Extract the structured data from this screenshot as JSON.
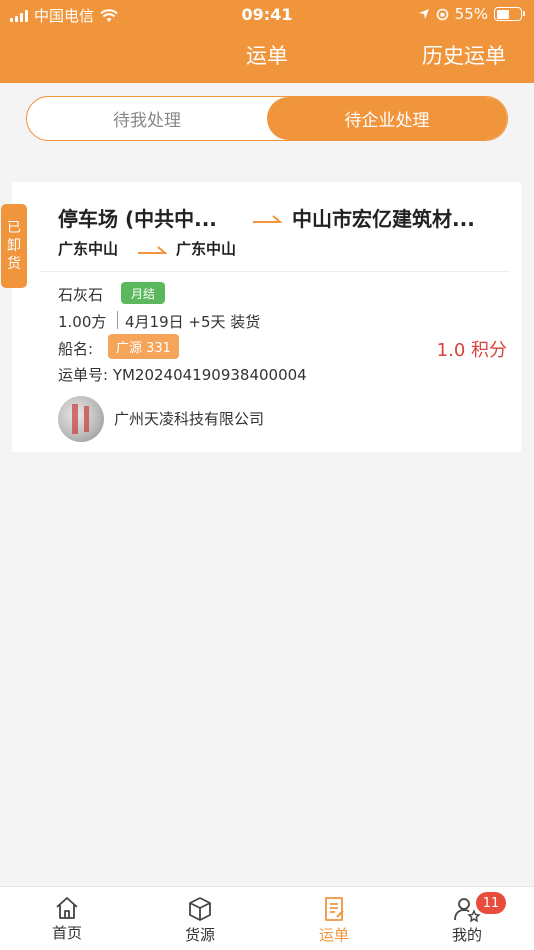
{
  "status_bar": {
    "carrier": "中国电信",
    "time": "09:41",
    "battery": "55%"
  },
  "nav": {
    "title": "运单",
    "history": "历史运单"
  },
  "segments": {
    "left": "待我处理",
    "right": "待企业处理"
  },
  "order": {
    "status_line1": "已",
    "status_line2": "卸",
    "status_line3": "货",
    "from": "停车场 (中共中...",
    "to": "中山市宏亿建筑材...",
    "from_region": "广东中山",
    "to_region": "广东中山",
    "cargo": "石灰石",
    "settle_badge": "月结",
    "quantity": "1.00方",
    "schedule": "4月19日 +5天 装货",
    "ship_label": "船名:",
    "ship_name": "广源 331",
    "points": "1.0 积分",
    "waybill": "运单号: YM202404190938400004",
    "company": "广州天凌科技有限公司"
  },
  "tabbar": {
    "home": "首页",
    "goods": "货源",
    "waybill": "运单",
    "mine": "我的",
    "mine_badge": "11"
  },
  "colors": {
    "accent": "#f0953c",
    "points_red": "#d9443a",
    "badge_green": "#5cb85c",
    "badge_red": "#e84c3d"
  }
}
